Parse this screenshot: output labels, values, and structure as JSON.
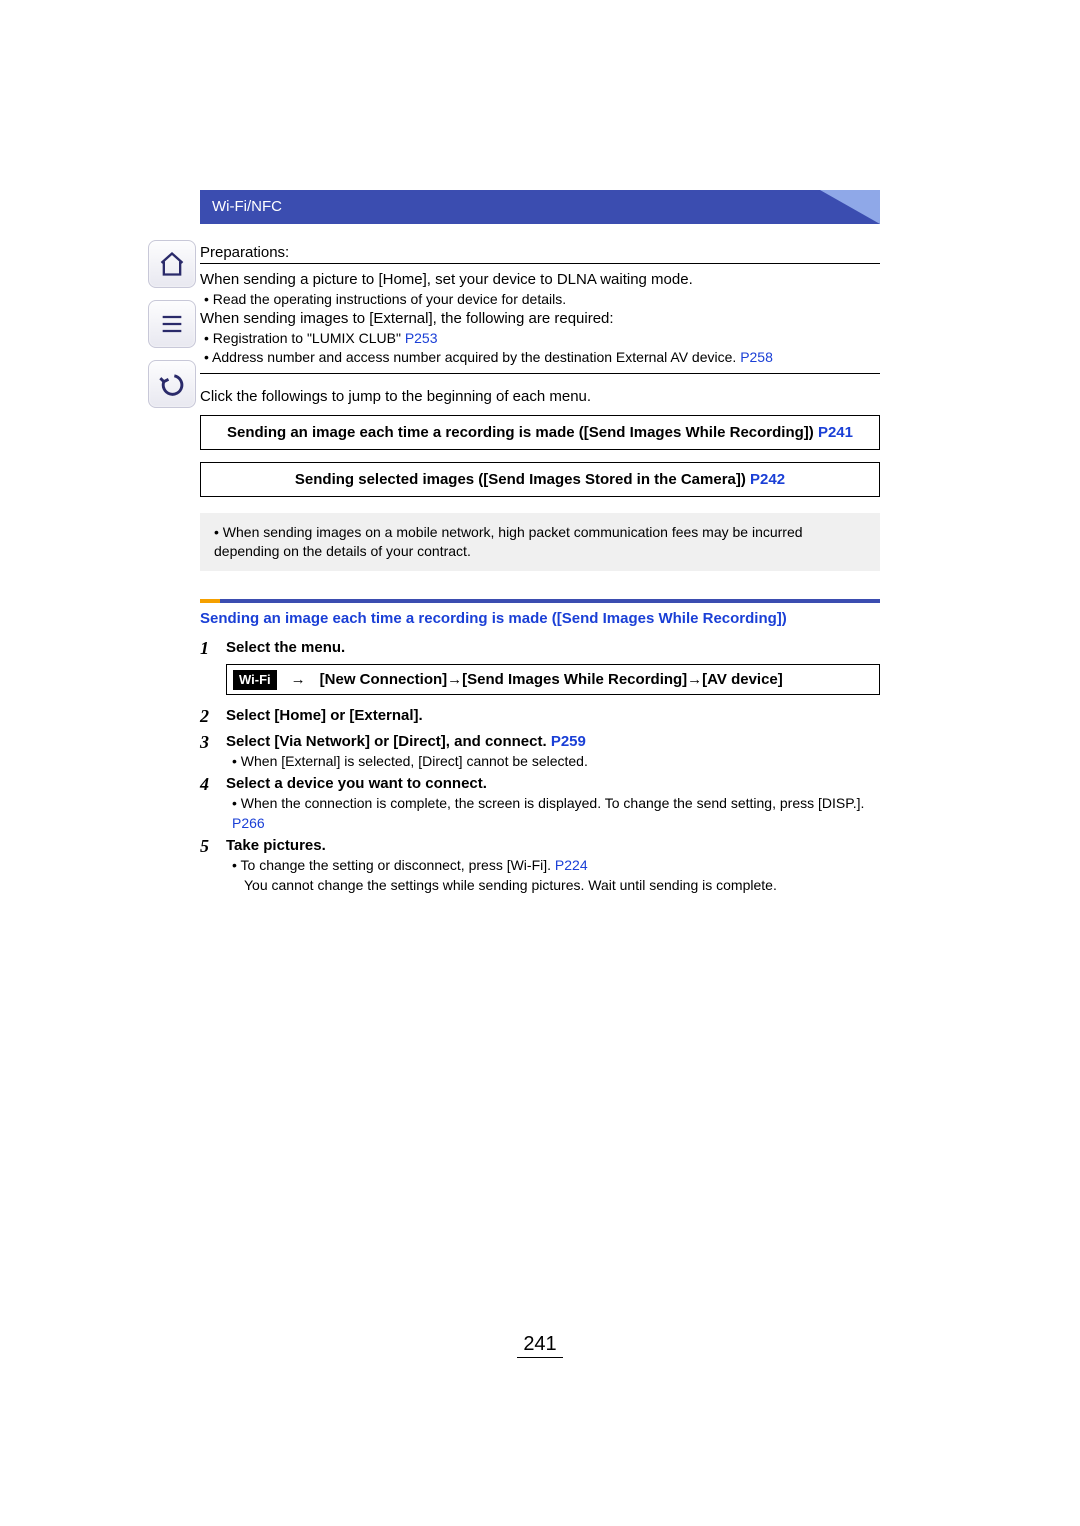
{
  "header": {
    "breadcrumb": "Wi-Fi/NFC"
  },
  "sidebar": {
    "home": "home-icon",
    "toc": "toc-icon",
    "back": "back-icon"
  },
  "prep": {
    "title": "Preparations:",
    "line1": "When sending a picture to [Home], set your device to DLNA waiting mode.",
    "bullet1": "Read the operating instructions of your device for details.",
    "line2": "When sending images to [External], the following are required:",
    "bullet2_pre": "Registration to \"LUMIX CLUB\" ",
    "bullet2_link": "P253",
    "bullet3_pre": "Address number and access number acquired by the destination External AV device. ",
    "bullet3_link": "P258"
  },
  "jump": {
    "intro": "Click the followings to jump to the beginning of each menu.",
    "box1_text": "Sending an image each time a recording is made ([Send Images While Recording]) ",
    "box1_link": "P241",
    "box2_text": "Sending selected images ([Send Images Stored in the Camera]) ",
    "box2_link": "P242"
  },
  "note": {
    "text": "When sending images on a mobile network, high packet communication fees may be incurred depending on the details of your contract."
  },
  "section": {
    "title": "Sending an image each time a recording is made ([Send Images While Recording])"
  },
  "steps": {
    "s1": {
      "num": "1",
      "title": "Select the menu.",
      "badge": "Wi-Fi",
      "arrow": "→",
      "path": "[New Connection]→[Send Images While Recording]→[AV device]"
    },
    "s2": {
      "num": "2",
      "title": "Select [Home] or [External]."
    },
    "s3": {
      "num": "3",
      "title_pre": "Select [Via Network] or [Direct], and connect. ",
      "title_link": "P259",
      "sub": "When [External] is selected, [Direct] cannot be selected."
    },
    "s4": {
      "num": "4",
      "title": "Select a device you want to connect.",
      "sub_pre": "When the connection is complete, the screen is displayed. To change the send setting, press [DISP.]. ",
      "sub_link": "P266"
    },
    "s5": {
      "num": "5",
      "title": "Take pictures.",
      "sub1_pre": "To change the setting or disconnect, press [Wi-Fi]. ",
      "sub1_link": "P224",
      "sub2": "You cannot change the settings while sending pictures. Wait until sending is complete."
    }
  },
  "page_number": "241"
}
